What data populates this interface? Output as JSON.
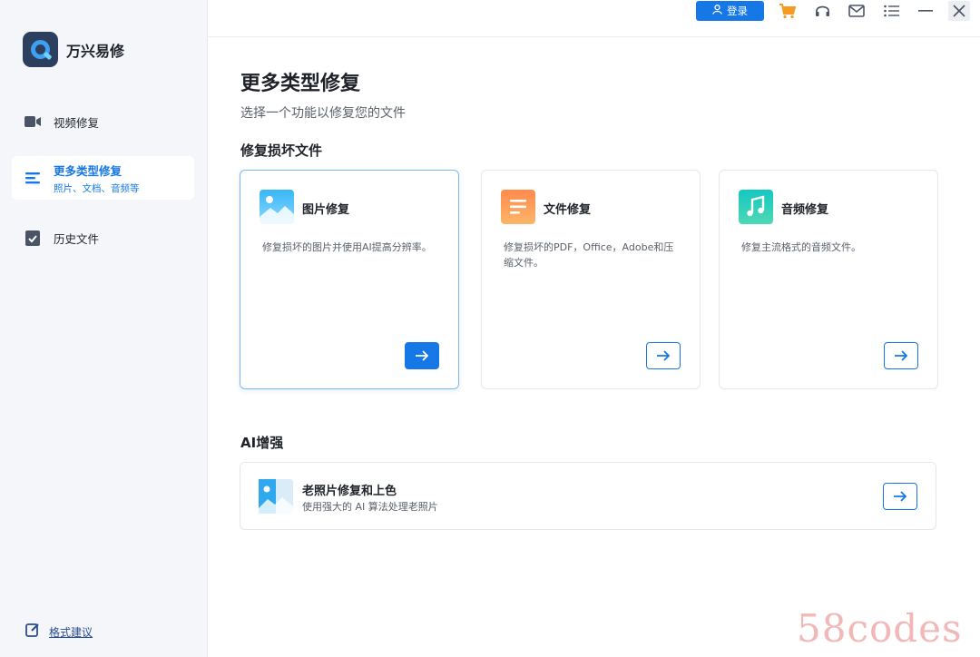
{
  "app": {
    "name": "万兴易修"
  },
  "sidebar": {
    "items": [
      {
        "label": "视频修复"
      },
      {
        "label": "更多类型修复",
        "sub": "照片、文档、音频等"
      },
      {
        "label": "历史文件"
      }
    ],
    "feedback": "格式建议"
  },
  "topbar": {
    "login": "登录"
  },
  "main": {
    "title": "更多类型修复",
    "subtitle": "选择一个功能以修复您的文件",
    "section_repair": "修复损坏文件",
    "cards": [
      {
        "title": "图片修复",
        "desc": "修复损坏的图片并使用AI提高分辨率。"
      },
      {
        "title": "文件修复",
        "desc": "修复损坏的PDF，Office，Adobe和压缩文件。"
      },
      {
        "title": "音频修复",
        "desc": "修复主流格式的音频文件。"
      }
    ],
    "section_ai": "AI增强",
    "ai_card": {
      "title": "老照片修复和上色",
      "desc": "使用强大的 AI 算法处理老照片"
    }
  },
  "watermark": "58codes",
  "colors": {
    "accent": "#1677e6",
    "sidebar_bg": "#f4f6f9",
    "cart": "#f59a23"
  }
}
